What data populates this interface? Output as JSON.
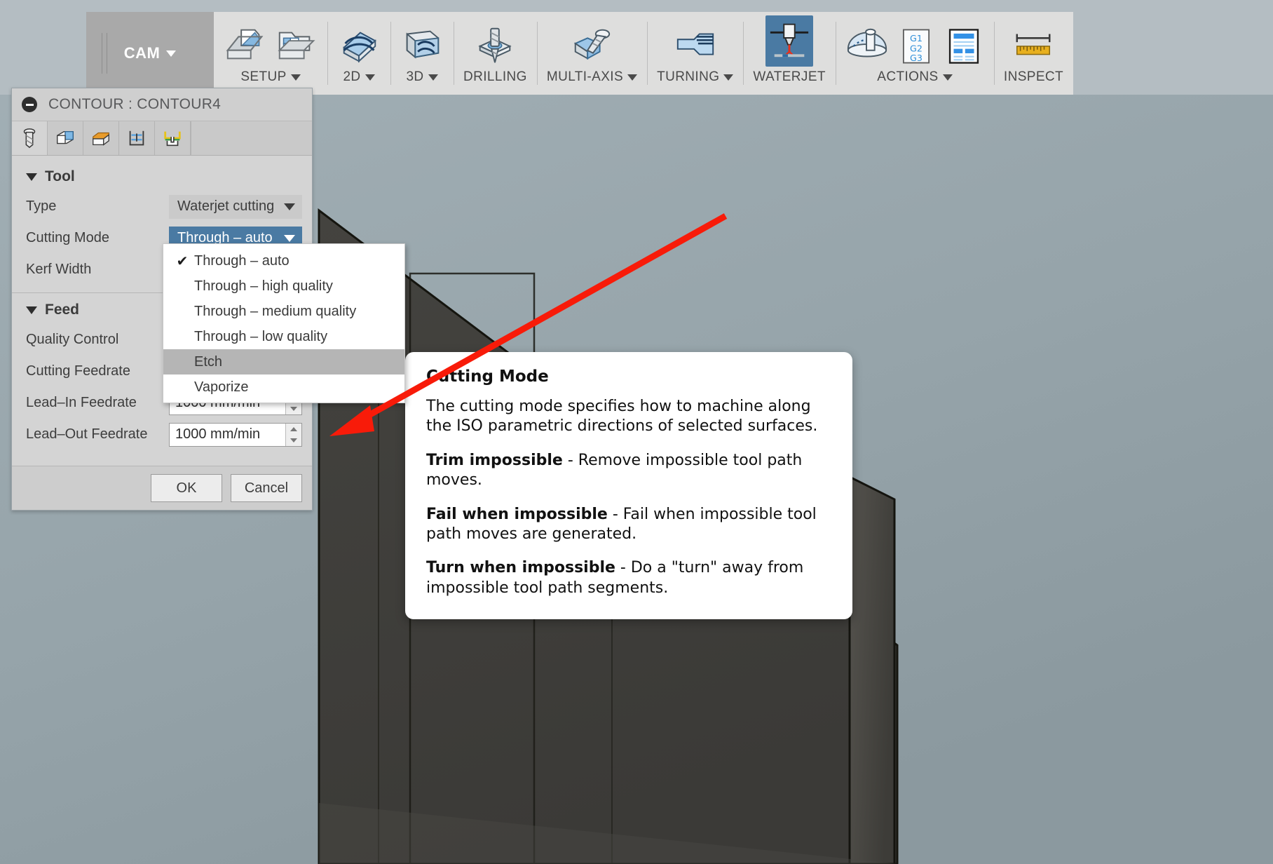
{
  "ribbon": {
    "cam": {
      "label": "CAM",
      "icon": "chevron-down-icon"
    },
    "groups": [
      {
        "name": "setup",
        "label": "SETUP",
        "has_caret": true,
        "icons": [
          "setup-new-icon",
          "setup-folder-icon"
        ]
      },
      {
        "name": "2d",
        "label": "2D",
        "has_caret": true,
        "icons": [
          "milling-2d-icon"
        ]
      },
      {
        "name": "3d",
        "label": "3D",
        "has_caret": true,
        "icons": [
          "milling-3d-icon"
        ]
      },
      {
        "name": "drilling",
        "label": "DRILLING",
        "has_caret": false,
        "icons": [
          "drill-icon"
        ]
      },
      {
        "name": "multi-axis",
        "label": "MULTI-AXIS",
        "has_caret": true,
        "icons": [
          "multi-axis-icon"
        ]
      },
      {
        "name": "turning",
        "label": "TURNING",
        "has_caret": true,
        "icons": [
          "turning-icon"
        ]
      },
      {
        "name": "waterjet",
        "label": "WATERJET",
        "has_caret": false,
        "icons": [
          "waterjet-icon"
        ],
        "selected": true
      },
      {
        "name": "actions",
        "label": "ACTIONS",
        "has_caret": true,
        "icons": [
          "probe-icon",
          "g-code-icon",
          "setup-sheet-icon"
        ]
      },
      {
        "name": "inspect",
        "label": "INSPECT",
        "has_caret": false,
        "icons": [
          "ruler-icon"
        ]
      }
    ]
  },
  "dialog": {
    "title": "CONTOUR : CONTOUR4",
    "collapse_icon": "minus-circle-icon",
    "tabs": [
      {
        "name": "tool",
        "icon": "tool-bolt-icon",
        "active": true
      },
      {
        "name": "geometry",
        "icon": "geometry-cube-icon",
        "active": false
      },
      {
        "name": "heights",
        "icon": "heights-cube-icon",
        "active": false
      },
      {
        "name": "passes",
        "icon": "passes-icon",
        "active": false
      },
      {
        "name": "linking",
        "icon": "linking-icon",
        "active": false
      }
    ],
    "sections": [
      {
        "name": "tool",
        "title": "Tool",
        "rows": [
          {
            "name": "type",
            "label": "Type",
            "control": "combo",
            "value": "Waterjet cutting",
            "selected": false
          },
          {
            "name": "cutting-mode",
            "label": "Cutting Mode",
            "control": "combo",
            "value": "Through – auto",
            "selected": true
          },
          {
            "name": "kerf-width",
            "label": "Kerf Width",
            "control": "none",
            "value": ""
          }
        ]
      },
      {
        "name": "feed",
        "title": "Feed",
        "rows": [
          {
            "name": "quality-control",
            "label": "Quality Control",
            "control": "none",
            "value": ""
          },
          {
            "name": "cutting-feedrate",
            "label": "Cutting Feedrate",
            "control": "none",
            "value": ""
          },
          {
            "name": "lead-in-feedrate",
            "label": "Lead–In Feedrate",
            "control": "spin",
            "value": "1000 mm/min"
          },
          {
            "name": "lead-out-feedrate",
            "label": "Lead–Out Feedrate",
            "control": "spin",
            "value": "1000 mm/min"
          }
        ]
      }
    ],
    "buttons": {
      "ok": "OK",
      "cancel": "Cancel"
    }
  },
  "dropdown": {
    "name": "cutting-mode-menu",
    "items": [
      {
        "label": "Through – auto",
        "checked": true,
        "highlighted": false
      },
      {
        "label": "Through – high quality",
        "checked": false,
        "highlighted": false
      },
      {
        "label": "Through – medium quality",
        "checked": false,
        "highlighted": false
      },
      {
        "label": "Through – low quality",
        "checked": false,
        "highlighted": false
      },
      {
        "label": "Etch",
        "checked": false,
        "highlighted": true
      },
      {
        "label": "Vaporize",
        "checked": false,
        "highlighted": false
      }
    ],
    "check_glyph": "✔"
  },
  "tooltip": {
    "title": "Cutting Mode",
    "intro": "The cutting mode specifies how to machine along the ISO parametric directions of selected surfaces.",
    "items": [
      {
        "term": "Trim impossible",
        "dash": " - ",
        "text": "Remove impossible tool path moves."
      },
      {
        "term": "Fail when impossible",
        "dash": " - ",
        "text": "Fail when impossible tool path moves are generated."
      },
      {
        "term": "Turn when impossible",
        "dash": " - ",
        "text": "Do a \"turn\" away from impossible tool path segments."
      }
    ]
  },
  "annotation": {
    "name": "red-arrow",
    "color": "#f81b09",
    "points_to": "Etch"
  },
  "colors": {
    "accent_blue": "#4a7aa3",
    "ribbon_bg": "#b4bdc2",
    "panel_bg": "#dededd",
    "dialog_bg": "#d4d4d4",
    "viewport_bg": "#96a4aa",
    "model_dark": "#3f3f3f",
    "highlight_gray": "#b5b5b5"
  }
}
